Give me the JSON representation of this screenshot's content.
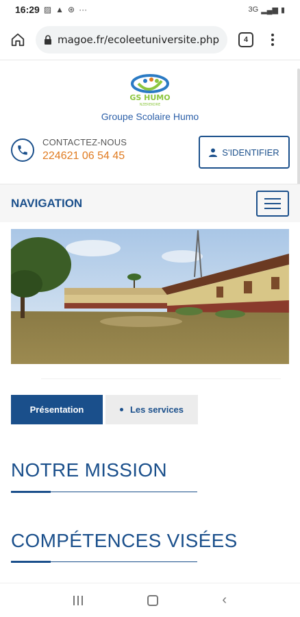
{
  "status_bar": {
    "time": "16:29",
    "more": "···",
    "network": "3G"
  },
  "browser": {
    "url": "magoe.fr/ecoleetuniversite.php",
    "tab_count": "4"
  },
  "site": {
    "school_name": "Groupe Scolaire Humo",
    "logo_text": "GS HUMO",
    "logo_subtext": "NZEREKORE",
    "contact_label": "CONTACTEZ-NOUS",
    "phone": "224621 06 54 45",
    "login_label": "S'IDENTIFIER",
    "nav_label": "NAVIGATION"
  },
  "tabs": [
    {
      "label": "Présentation",
      "active": true
    },
    {
      "label": "Les services",
      "active": false
    }
  ],
  "sections": {
    "mission": "NOTRE MISSION",
    "competences": "COMPÉTENCES VISÉES"
  },
  "colors": {
    "primary": "#1a4f8b",
    "accent": "#e07a1f",
    "logo_green": "#8cc63f"
  }
}
